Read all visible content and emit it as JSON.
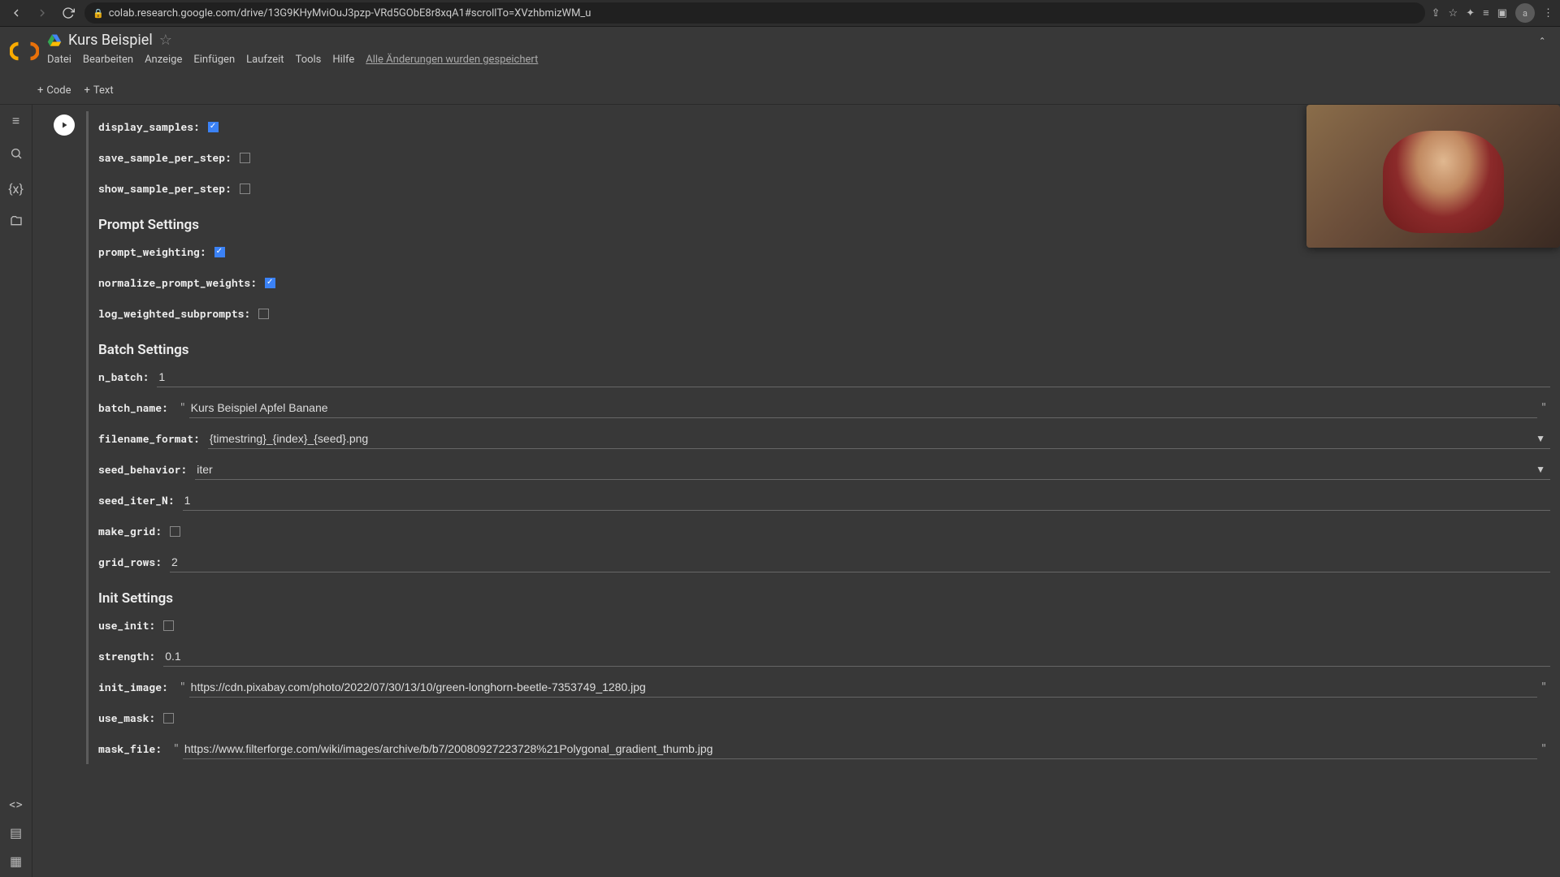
{
  "browser": {
    "url": "colab.research.google.com/drive/13G9KHyMviOuJ3pzp-VRd5GObE8r8xqA1#scrollTo=XVzhbmizWM_u",
    "avatar": "a"
  },
  "header": {
    "title": "Kurs Beispiel",
    "menu": [
      "Datei",
      "Bearbeiten",
      "Anzeige",
      "Einfügen",
      "Laufzeit",
      "Tools",
      "Hilfe"
    ],
    "save_status": "Alle Änderungen wurden gespeichert"
  },
  "toolbar": {
    "code": "Code",
    "text": "Text"
  },
  "form": {
    "display_samples": {
      "label": "display_samples:",
      "checked": true
    },
    "save_sample_per_step": {
      "label": "save_sample_per_step:",
      "checked": false
    },
    "show_sample_per_step": {
      "label": "show_sample_per_step:",
      "checked": false
    },
    "prompt_heading": "Prompt Settings",
    "prompt_weighting": {
      "label": "prompt_weighting:",
      "checked": true
    },
    "normalize_prompt_weights": {
      "label": "normalize_prompt_weights:",
      "checked": true
    },
    "log_weighted_subprompts": {
      "label": "log_weighted_subprompts:",
      "checked": false
    },
    "batch_heading": "Batch Settings",
    "n_batch": {
      "label": "n_batch:",
      "value": "1"
    },
    "batch_name": {
      "label": "batch_name:",
      "value": "Kurs Beispiel Apfel Banane"
    },
    "filename_format": {
      "label": "filename_format:",
      "value": "{timestring}_{index}_{seed}.png"
    },
    "seed_behavior": {
      "label": "seed_behavior:",
      "value": "iter"
    },
    "seed_iter_N": {
      "label": "seed_iter_N:",
      "value": "1"
    },
    "make_grid": {
      "label": "make_grid:",
      "checked": false
    },
    "grid_rows": {
      "label": "grid_rows:",
      "value": "2"
    },
    "init_heading": "Init Settings",
    "use_init": {
      "label": "use_init:",
      "checked": false
    },
    "strength": {
      "label": "strength:",
      "value": "0.1"
    },
    "init_image": {
      "label": "init_image:",
      "value": "https://cdn.pixabay.com/photo/2022/07/30/13/10/green-longhorn-beetle-7353749_1280.jpg"
    },
    "use_mask": {
      "label": "use_mask:",
      "checked": false
    },
    "mask_file": {
      "label": "mask_file:",
      "value": "https://www.filterforge.com/wiki/images/archive/b/b7/20080927223728%21Polygonal_gradient_thumb.jpg"
    }
  }
}
